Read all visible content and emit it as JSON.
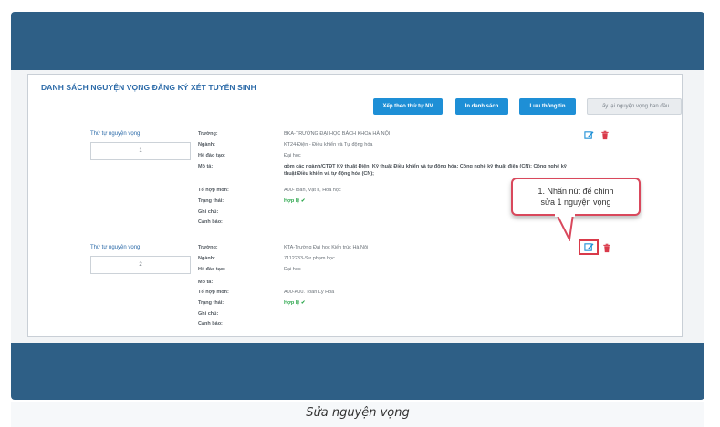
{
  "title": "DANH SÁCH NGUYỆN VỌNG ĐĂNG KÝ XÉT TUYỂN SINH",
  "buttons": {
    "sort": "Xếp theo thứ tự NV",
    "print": "In danh sách",
    "save": "Lưu thông tin",
    "restore": "Lấy lại nguyện vọng ban đầu"
  },
  "order_label": "Thứ tự nguyện vọng",
  "field_labels": {
    "school": "Trường:",
    "major": "Ngành:",
    "training": "Hệ đào tạo:",
    "description": "Mô tả:",
    "subjects": "Tổ hợp môn:",
    "status": "Trạng thái:",
    "note": "Ghi chú:",
    "warning": "Cảnh báo:"
  },
  "items": [
    {
      "order": "1",
      "school": "BKA-TRƯỜNG ĐẠI HỌC BÁCH KHOA HÀ NỘI",
      "major": "KT24-Điện - Điều khiển và Tự động hóa",
      "training": "Đại học",
      "description": "gồm các ngành/CTĐT Kỹ thuật Điện; Kỹ thuật Điều khiển và tự động hóa; Công nghệ kỹ thuật điện (CN); Công nghệ kỹ thuật Điều khiển và tự động hóa (CN);",
      "subjects": "A00-Toán, Vật lí, Hóa học",
      "status": "Hợp lệ"
    },
    {
      "order": "2",
      "school": "KTA-Trường Đại học Kiến trúc Hà Nội",
      "major": "7112233-Sư phạm học",
      "training": "Đại học",
      "description": "",
      "subjects": "A00-A00. Toán Lý Hóa",
      "status": "Hợp lệ"
    }
  ],
  "callout": {
    "line1": "1. Nhấn nút để chỉnh",
    "line2": "sửa 1 nguyện vọng"
  },
  "caption": "Sửa nguyện vọng",
  "colors": {
    "band": "#2e5f86",
    "accent": "#1e8fd6",
    "status_ok": "#2fa84f",
    "delete": "#d93a4a"
  },
  "icons": [
    "edit-icon",
    "trash-icon",
    "check-icon"
  ]
}
